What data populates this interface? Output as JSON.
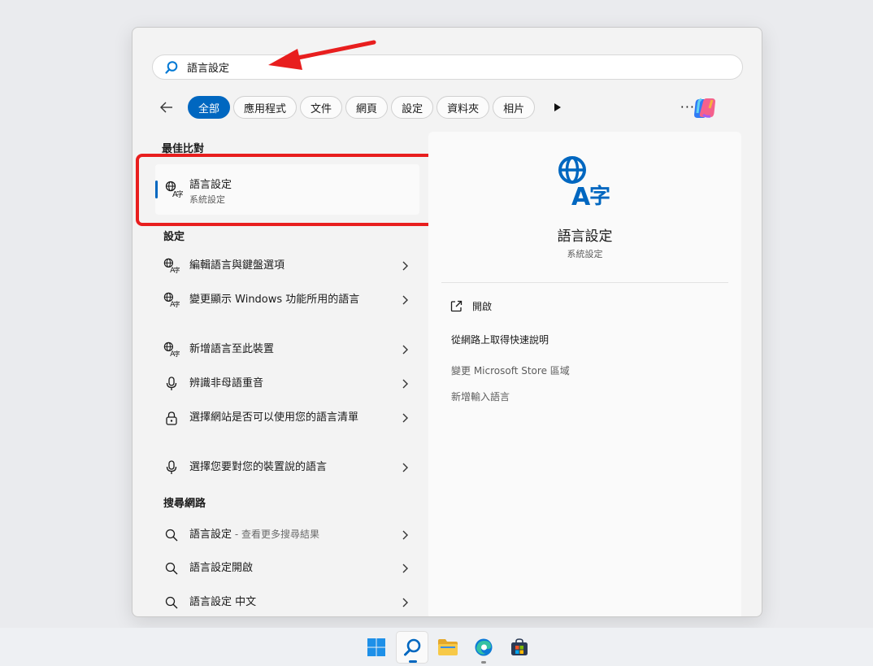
{
  "search": {
    "value": "語言設定",
    "placeholder": ""
  },
  "filters": {
    "chips": [
      {
        "label": "全部",
        "active": true
      },
      {
        "label": "應用程式"
      },
      {
        "label": "文件"
      },
      {
        "label": "網頁"
      },
      {
        "label": "設定"
      },
      {
        "label": "資料夾"
      },
      {
        "label": "相片"
      }
    ],
    "more": "···"
  },
  "best_match": {
    "section_title": "最佳比對",
    "title": "語言設定",
    "subtitle": "系統設定",
    "icon": "language-icon"
  },
  "settings": {
    "section_title": "設定",
    "items": [
      {
        "label": "編輯語言與鍵盤選項",
        "icon": "language-icon"
      },
      {
        "label": "變更顯示 Windows 功能所用的語言",
        "icon": "language-icon"
      },
      {
        "label": "新增語言至此裝置",
        "icon": "language-icon"
      },
      {
        "label": "辨識非母語重音",
        "icon": "microphone-icon"
      },
      {
        "label": "選擇網站是否可以使用您的語言清單",
        "icon": "lock-icon"
      },
      {
        "label": "選擇您要對您的裝置說的語言",
        "icon": "microphone-icon"
      }
    ]
  },
  "web": {
    "section_title": "搜尋網路",
    "items": [
      {
        "label": "語言設定",
        "suffix": " - 查看更多搜尋結果",
        "icon": "search-icon"
      },
      {
        "label": "語言設定開啟",
        "icon": "search-icon"
      },
      {
        "label": "語言設定 中文",
        "icon": "search-icon"
      }
    ]
  },
  "preview": {
    "title": "語言設定",
    "subtitle": "系統設定",
    "open_label": "開啟",
    "links": [
      "從網路上取得快速說明",
      "變更 Microsoft Store 區域",
      "新增輸入語言"
    ]
  },
  "colors": {
    "accent": "#0067c0",
    "annotation": "#e81e1e"
  }
}
